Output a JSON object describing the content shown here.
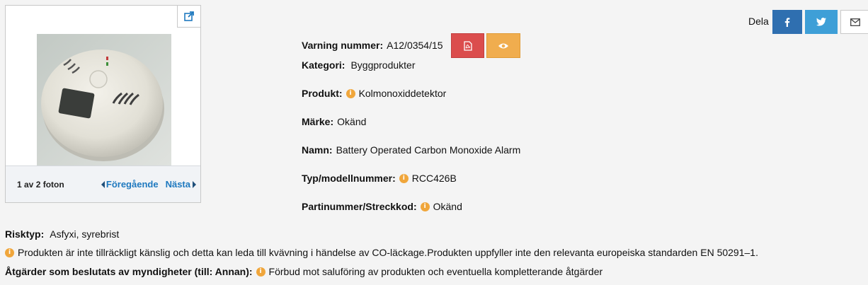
{
  "gallery": {
    "photo_count": "1 av 2 foton",
    "prev_label": "Föregående",
    "next_label": "Nästa"
  },
  "warning": {
    "number_label": "Varning nummer:",
    "number_value": "A12/0354/15",
    "category_label": "Kategori:",
    "category_value": "Byggprodukter",
    "product_label": "Produkt:",
    "product_value": "Kolmonoxiddetektor",
    "brand_label": "Märke:",
    "brand_value": "Okänd",
    "name_label": "Namn:",
    "name_value": "Battery Operated Carbon Monoxide Alarm",
    "model_label": "Typ/modellnummer:",
    "model_value": "RCC426B",
    "batch_label": "Partinummer/Streckkod:",
    "batch_value": "Okänd"
  },
  "share": {
    "label": "Dela"
  },
  "risk": {
    "type_label": "Risktyp:",
    "type_value": "Asfyxi, syrebrist",
    "description": "Produkten är inte tillräckligt känslig och detta kan leda till kvävning i händelse av CO-läckage.Produkten uppfyller inte den relevanta europeiska standarden EN 50291–1.",
    "measures_label": "Åtgärder som beslutats av myndigheter (till: Annan):",
    "measures_value": "Förbud mot saluföring av produkten och eventuella kompletterande åtgärder"
  },
  "colors": {
    "pdf_button": "#db4d4d",
    "view_button": "#f0ad4e",
    "facebook": "#2f6fb0",
    "twitter": "#3e9fd7",
    "link": "#1f79bf",
    "info_icon": "#f0a63b"
  },
  "icons": {
    "expand": "expand-icon",
    "pdf": "pdf-icon",
    "view": "eye-icon",
    "facebook": "facebook-icon",
    "twitter": "twitter-icon",
    "mail": "mail-icon",
    "info": "info-icon"
  }
}
